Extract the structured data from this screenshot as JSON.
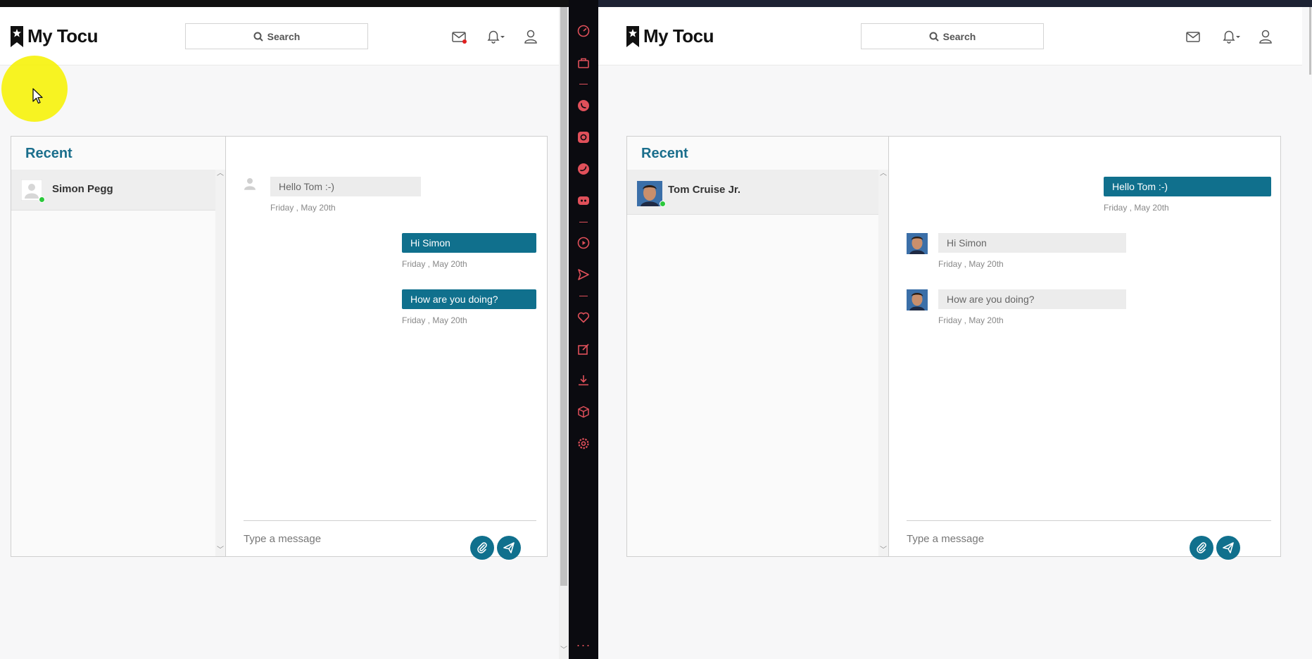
{
  "colors": {
    "accent": "#10708d",
    "recent_title": "#1a6e8c",
    "online": "#2bc83b",
    "dock_bg": "#0b0b10",
    "dock_icon": "#e0505a",
    "cursor_highlight": "#f6f20a"
  },
  "left_app": {
    "logo": "My Tocu",
    "search_label": "Search",
    "header_icons": [
      "mail-icon",
      "bell-icon",
      "user-icon"
    ],
    "mail_unread_dot": true,
    "recent_title": "Recent",
    "contact": {
      "name": "Simon Pegg",
      "online": true,
      "avatar": "default-avatar"
    },
    "messages": [
      {
        "direction": "in",
        "text": "Hello Tom :-)",
        "date": "Friday , May 20th"
      },
      {
        "direction": "out",
        "text": "Hi Simon",
        "date": "Friday , May 20th"
      },
      {
        "direction": "out",
        "text": "How are you doing?",
        "date": "Friday , May 20th"
      }
    ],
    "composer_placeholder": "Type a message"
  },
  "right_app": {
    "logo": "My Tocu",
    "search_label": "Search",
    "header_icons": [
      "mail-icon",
      "bell-icon",
      "user-icon"
    ],
    "recent_title": "Recent",
    "contact": {
      "name": "Tom Cruise Jr.",
      "online": true,
      "avatar": "photo-avatar"
    },
    "messages": [
      {
        "direction": "out",
        "text": "Hello Tom :-)",
        "date": "Friday , May 20th"
      },
      {
        "direction": "in",
        "text": "Hi Simon",
        "date": "Friday , May 20th"
      },
      {
        "direction": "in",
        "text": "How are you doing?",
        "date": "Friday , May 20th"
      }
    ],
    "composer_placeholder": "Type a message"
  },
  "dock": {
    "icons": [
      "gauge-icon",
      "bag-icon",
      "whatsapp-icon",
      "instagram-icon",
      "twitter-icon",
      "discord-icon",
      "play-icon",
      "send-icon",
      "heart-icon",
      "edit-icon",
      "download-icon",
      "box-icon",
      "settings-icon"
    ],
    "more_label": "···"
  }
}
